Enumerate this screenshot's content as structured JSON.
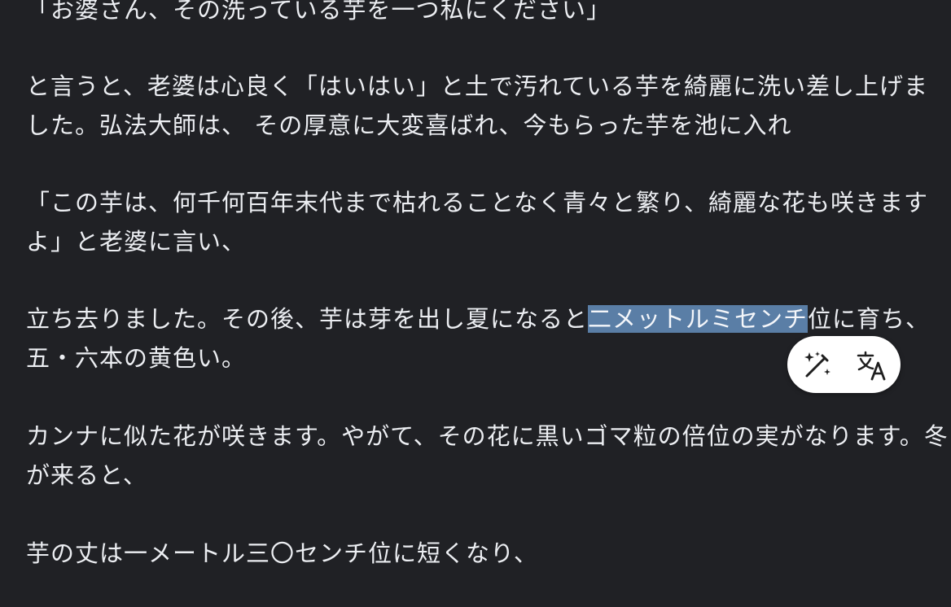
{
  "reader": {
    "lines": [
      "「お婆さん、その洗っている芋を一つ私にください」",
      "と言うと、老婆は心良く「はいはい」と土で汚れている芋を綺麗に洗い差し上げま",
      "した。弘法大師は、 その厚意に大変喜ばれ、今もらった芋を池に入れ",
      "「この芋は、何千何百年末代まで枯れることなく青々と繁り、綺麗な花も咲きます",
      "よ」と老婆に言い、",
      "五・六本の黄色い。",
      "カンナに似た花が咲きます。やがて、その花に黒いゴマ粒の倍位の実がなります。冬",
      "が来ると、",
      "芋の丈は一メートル三〇センチ位に短くなり、"
    ],
    "selection_line": {
      "before": "立ち去りました。その後、芋は芽を出し夏になると",
      "selected": "二メットルミセンチ",
      "after": "位に育ち、"
    }
  },
  "selection_popup": {
    "magic_icon": "magic-wand-icon",
    "translate_icon": "translate-icon"
  },
  "colors": {
    "background": "#202125",
    "text": "#eceef2",
    "selection": "#5a7ea6",
    "popup": "#ffffff",
    "icon": "#1f1f1f"
  }
}
